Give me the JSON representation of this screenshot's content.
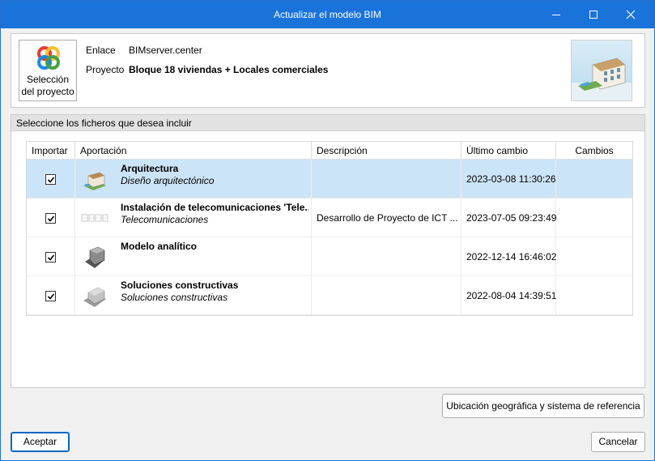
{
  "window": {
    "title": "Actualizar el modelo BIM"
  },
  "header": {
    "project_button_label_line1": "Selección",
    "project_button_label_line2": "del proyecto",
    "link_key": "Enlace",
    "link_value": "BIMserver.center",
    "project_key": "Proyecto",
    "project_value": "Bloque 18 viviendas + Locales comerciales"
  },
  "files": {
    "heading": "Seleccione los ficheros que desea incluir",
    "columns": {
      "import": "Importar",
      "contribution": "Aportación",
      "description": "Descripción",
      "last_change": "Último cambio",
      "changes": "Cambios"
    },
    "rows": [
      {
        "checked": true,
        "title": "Arquitectura",
        "subtitle": "Diseño arquitectónico",
        "description": "",
        "last_change": "2023-03-08 11:30:26",
        "changes": "",
        "selected": true
      },
      {
        "checked": true,
        "title": "Instalación de telecomunicaciones 'Tele...",
        "subtitle": "Telecomunicaciones",
        "description": "Desarrollo de Proyecto de ICT ...",
        "last_change": "2023-07-05 09:23:49",
        "changes": "",
        "selected": false
      },
      {
        "checked": true,
        "title": "Modelo analítico",
        "subtitle": "",
        "description": "",
        "last_change": "2022-12-14 16:46:02",
        "changes": "",
        "selected": false
      },
      {
        "checked": true,
        "title": "Soluciones constructivas",
        "subtitle": "Soluciones constructivas",
        "description": "",
        "last_change": "2022-08-04 14:39:51",
        "changes": "",
        "selected": false
      }
    ]
  },
  "buttons": {
    "geo": "Ubicación geográfica y sistema de referencia",
    "accept": "Aceptar",
    "cancel": "Cancelar"
  },
  "colors": {
    "titlebar": "#1a73d9",
    "selected_row": "#cce4f7"
  }
}
